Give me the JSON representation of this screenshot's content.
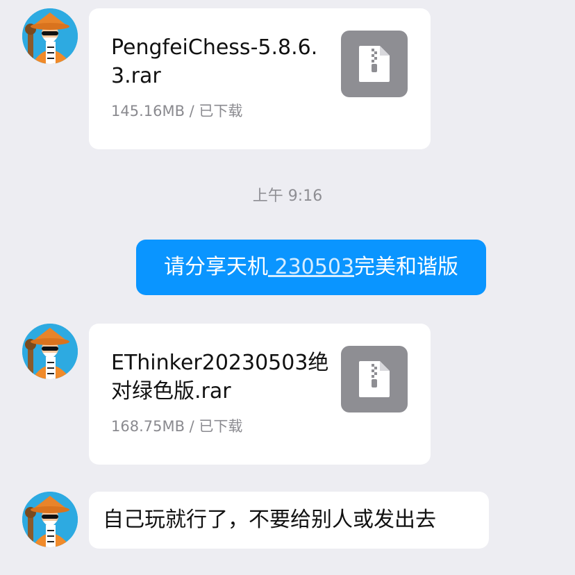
{
  "messages": [
    {
      "type": "file",
      "sender": "other",
      "file_name": "PengfeiChess-5.8.6.3.rar",
      "file_meta": "145.16MB / 已下载",
      "icon": "zip-file-icon"
    },
    {
      "type": "timestamp",
      "text": "上午 9:16"
    },
    {
      "type": "text",
      "sender": "self",
      "text_before": "请分享天机",
      "link_text": " 230503",
      "text_after": "完美和谐版"
    },
    {
      "type": "file",
      "sender": "other",
      "file_name": "EThinker20230503绝对绿色版.rar",
      "file_meta": "168.75MB / 已下载",
      "icon": "zip-file-icon"
    },
    {
      "type": "text",
      "sender": "other",
      "text": "自己玩就行了，不要给别人或发出去"
    }
  ],
  "colors": {
    "background": "#EDEDF2",
    "sent_bubble": "#0A95FF",
    "received_bubble": "#FFFFFF",
    "file_icon_bg": "#8E8E93",
    "meta_text": "#8A8A8F"
  }
}
